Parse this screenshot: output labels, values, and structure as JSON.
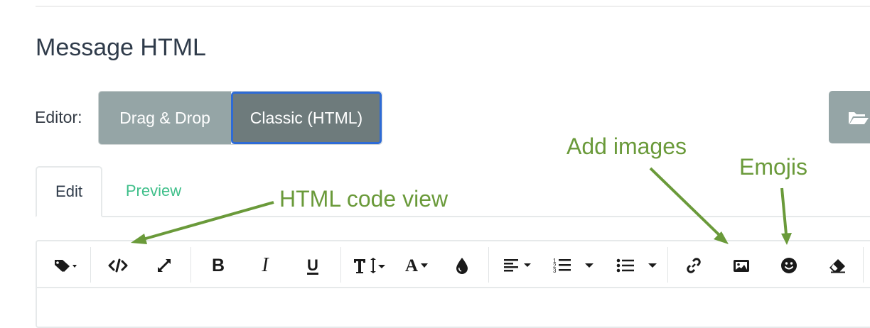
{
  "page": {
    "title": "Message HTML"
  },
  "editor": {
    "label": "Editor:",
    "modes": [
      {
        "label": "Drag & Drop",
        "active": false
      },
      {
        "label": "Classic (HTML)",
        "active": true
      }
    ]
  },
  "tabs": [
    {
      "label": "Edit",
      "active": true
    },
    {
      "label": "Preview",
      "active": false
    }
  ],
  "toolbar": {
    "groups": [
      [
        "tag-icon",
        "code-view-icon",
        "fullscreen-icon"
      ],
      [
        "bold-icon",
        "italic-icon",
        "underline-icon"
      ],
      [
        "font-size-icon",
        "font-color-icon",
        "highlight-icon"
      ],
      [
        "align-icon",
        "ordered-list-icon",
        "unordered-list-icon"
      ],
      [
        "link-icon",
        "image-icon",
        "emoji-icon",
        "eraser-icon"
      ]
    ]
  },
  "annotations": {
    "html_code_view": "HTML code view",
    "add_images": "Add images",
    "emojis": "Emojis"
  },
  "colors": {
    "annotation": "#6a9a3a",
    "mode_button": "#95a5a6",
    "mode_button_active": "#6e7b7c",
    "focus_outline": "#2e6bd6",
    "preview_tab": "#3fbf8a",
    "title": "#2f3b4a"
  }
}
